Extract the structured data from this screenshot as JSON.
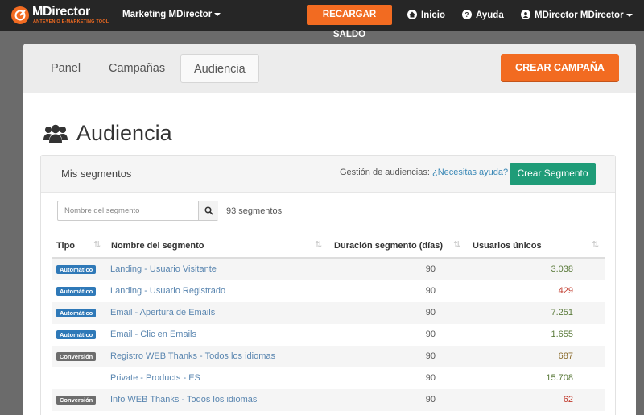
{
  "topnav": {
    "logo_name": "MDirector",
    "logo_tagline": "ANTEVENIO E-MARKETING TOOL",
    "account_menu": "Marketing MDirector",
    "recargar_label": "RECARGAR SALDO",
    "inicio_label": "Inicio",
    "ayuda_label": "Ayuda",
    "user_menu": "MDirector MDirector",
    "accent_color": "#f26b21"
  },
  "tabs": {
    "panel": "Panel",
    "campanas": "Campañas",
    "audiencia": "Audiencia",
    "active": "Audiencia",
    "crear_campana": "CREAR CAMPAÑA"
  },
  "page": {
    "title": "Audiencia",
    "title_icon": "users-icon"
  },
  "segments_panel": {
    "title": "Mis segmentos",
    "gestion_text": "Gestión de audiencias:",
    "help_link": "¿Necesitas ayuda?",
    "crear_segmento": "Crear Segmento",
    "search_placeholder": "Nombre del segmento",
    "count_text": "93 segmentos",
    "columns": [
      "Tipo",
      "Nombre del segmento",
      "Duración segmento (días)",
      "Usuarios únicos"
    ],
    "rows": [
      {
        "type": "Automático",
        "name": "Landing - Usuario Visitante",
        "duration": "90",
        "users": "3.038",
        "users_color": "#5a7a3a"
      },
      {
        "type": "Automático",
        "name": "Landing - Usuario Registrado",
        "duration": "90",
        "users": "429",
        "users_color": "#c0392b"
      },
      {
        "type": "Automático",
        "name": "Email - Apertura de Emails",
        "duration": "90",
        "users": "7.251",
        "users_color": "#5a7a3a"
      },
      {
        "type": "Automático",
        "name": "Email - Clic en Emails",
        "duration": "90",
        "users": "1.655",
        "users_color": "#5a7a3a"
      },
      {
        "type": "Conversión",
        "name": "Registro WEB Thanks - Todos los idiomas",
        "duration": "90",
        "users": "687",
        "users_color": "#8a6a2a"
      },
      {
        "type": "",
        "name": "Private - Products - ES",
        "duration": "90",
        "users": "15.708",
        "users_color": "#5a7a3a"
      },
      {
        "type": "Conversión",
        "name": "Info WEB Thanks - Todos los idiomas",
        "duration": "90",
        "users": "62",
        "users_color": "#c0392b"
      }
    ]
  }
}
